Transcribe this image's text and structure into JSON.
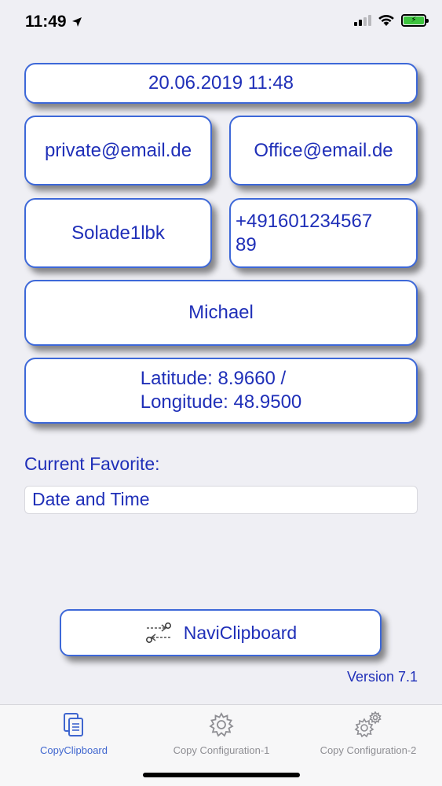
{
  "status_bar": {
    "time": "11:49",
    "location_icon": "location-arrow-icon",
    "signal_icon": "cellular-signal-icon",
    "wifi_icon": "wifi-icon",
    "battery_icon": "battery-charging-icon"
  },
  "cards": {
    "datetime": "20.06.2019 11:48",
    "private_email": "private@email.de",
    "office_email": "Office@email.de",
    "password": "Solade1lbk",
    "phone": "+491601234567\n89",
    "name": "Michael",
    "coordinates": "Latitude: 8.9660 /\nLongitude: 48.9500"
  },
  "favorite": {
    "label": "Current Favorite:",
    "value": "Date and Time"
  },
  "navi_button": {
    "icon": "route-map-icon",
    "label": "NaviClipboard"
  },
  "version": "Version 7.1",
  "tabs": [
    {
      "label": "CopyClipboard",
      "icon": "clipboard-documents-icon",
      "active": true
    },
    {
      "label": "Copy Configuration-1",
      "icon": "gear-icon",
      "active": false
    },
    {
      "label": "Copy Configuration-2",
      "icon": "gears-icon",
      "active": false
    }
  ],
  "colors": {
    "accent": "#3d68d8",
    "text": "#1f2fb8",
    "background": "#efeff4",
    "tab_inactive": "#8e8e93"
  }
}
